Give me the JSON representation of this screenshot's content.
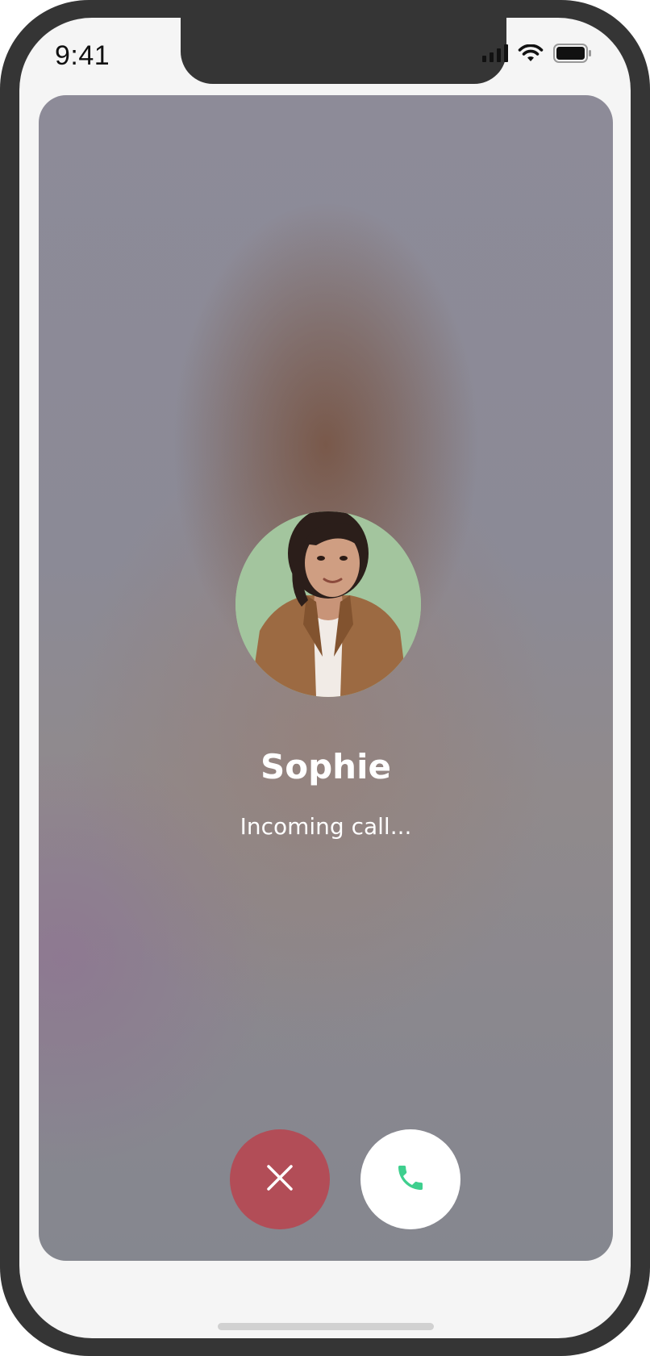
{
  "status_bar": {
    "time": "9:41",
    "icons": [
      "cellular-signal-icon",
      "wifi-icon",
      "battery-icon"
    ]
  },
  "call": {
    "caller_name": "Sophie",
    "status": "Incoming call...",
    "avatar": "caller-photo"
  },
  "actions": {
    "decline_icon": "close-icon",
    "accept_icon": "phone-icon"
  },
  "colors": {
    "decline": "#b24d57",
    "accept_icon": "#3ecf8e",
    "frame": "#353535",
    "screen_bg": "#f5f5f5"
  }
}
